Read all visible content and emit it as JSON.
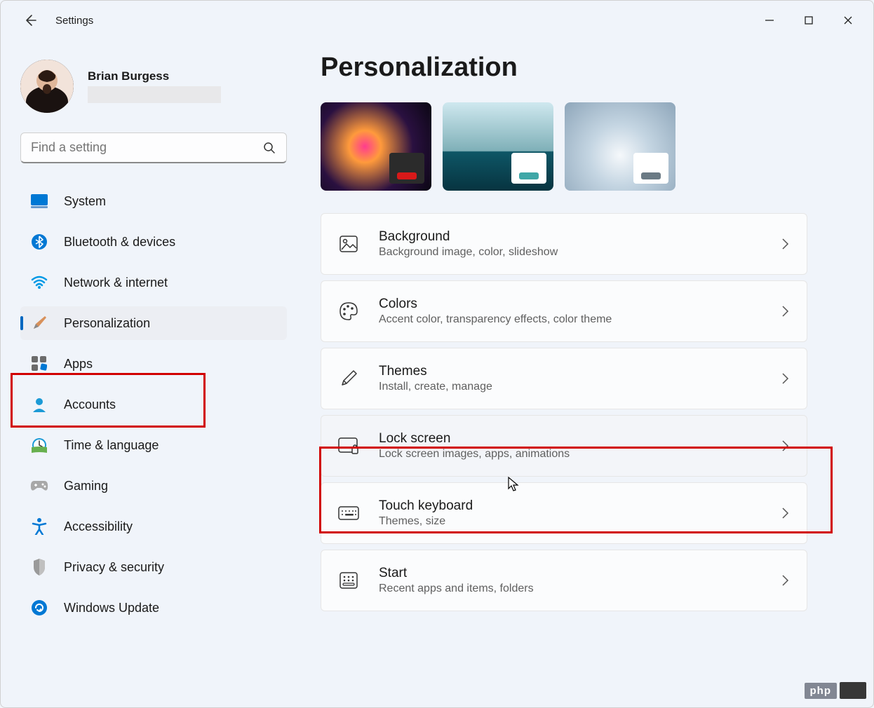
{
  "app_title": "Settings",
  "user": {
    "name": "Brian Burgess"
  },
  "search": {
    "placeholder": "Find a setting"
  },
  "sidebar": {
    "items": [
      {
        "label": "System",
        "icon": "system"
      },
      {
        "label": "Bluetooth & devices",
        "icon": "bluetooth"
      },
      {
        "label": "Network & internet",
        "icon": "wifi"
      },
      {
        "label": "Personalization",
        "icon": "brush",
        "selected": true
      },
      {
        "label": "Apps",
        "icon": "apps"
      },
      {
        "label": "Accounts",
        "icon": "accounts"
      },
      {
        "label": "Time & language",
        "icon": "time"
      },
      {
        "label": "Gaming",
        "icon": "gaming"
      },
      {
        "label": "Accessibility",
        "icon": "accessibility"
      },
      {
        "label": "Privacy & security",
        "icon": "privacy"
      },
      {
        "label": "Windows Update",
        "icon": "update"
      }
    ]
  },
  "page": {
    "title": "Personalization",
    "cards": [
      {
        "title": "Background",
        "desc": "Background image, color, slideshow",
        "icon": "image"
      },
      {
        "title": "Colors",
        "desc": "Accent color, transparency effects, color theme",
        "icon": "palette"
      },
      {
        "title": "Themes",
        "desc": "Install, create, manage",
        "icon": "pen"
      },
      {
        "title": "Lock screen",
        "desc": "Lock screen images, apps, animations",
        "icon": "lock-screen",
        "hover": true
      },
      {
        "title": "Touch keyboard",
        "desc": "Themes, size",
        "icon": "keyboard"
      },
      {
        "title": "Start",
        "desc": "Recent apps and items, folders",
        "icon": "start"
      }
    ]
  },
  "watermark": "php"
}
